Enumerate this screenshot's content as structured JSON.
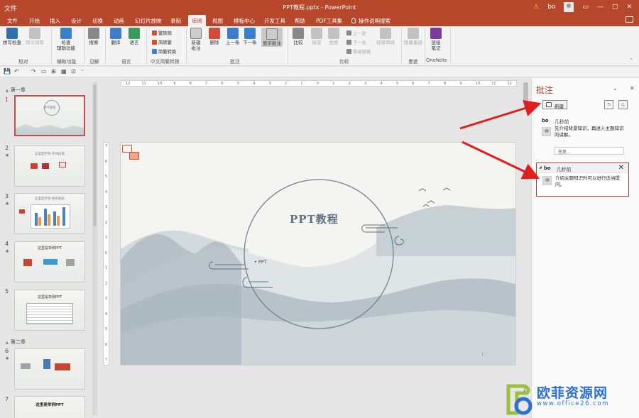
{
  "window": {
    "title": "PPT教程.pptx - PowerPoint",
    "user": "bo",
    "controls": [
      "—",
      "□",
      "✕"
    ]
  },
  "qat": {
    "save": "💾",
    "undo": "↶",
    "redo": "↷"
  },
  "tabs": [
    "文件",
    "开始",
    "插入",
    "设计",
    "切换",
    "动画",
    "幻灯片放映",
    "录制",
    "审阅",
    "视图",
    "模板中心",
    "开发工具",
    "帮助",
    "PDF工具集",
    "操作说明搜索"
  ],
  "active_tab": "审阅",
  "ribbon": {
    "proofing": {
      "label": "校对",
      "spell": "拼写检查",
      "thesaurus": "同义词库"
    },
    "accessibility": {
      "label": "辅助功能",
      "check": "检查\n辅助功能"
    },
    "insights": {
      "label": "见解",
      "search": "搜索"
    },
    "language": {
      "label": "语言",
      "translate": "翻译",
      "language": "语言"
    },
    "chinese": {
      "label": "中文简繁转换",
      "t2s": "繁转简",
      "s2t": "简转繁",
      "convert": "简繁转换"
    },
    "comments": {
      "label": "批注",
      "new": "新建\n批注",
      "delete": "删除",
      "prev": "上一条",
      "next": "下一条",
      "show": "显示批注"
    },
    "compare": {
      "label": "比较",
      "compare": "比较",
      "accept": "接受",
      "reject": "拒绝",
      "prev": "上一处",
      "next": "下一处",
      "pane": "审阅窗格",
      "end": "结束审阅"
    },
    "ink": {
      "label": "墨迹",
      "hide": "隐藏墨迹"
    },
    "onenote": {
      "label": "OneNote",
      "link": "链接\n笔记"
    }
  },
  "slides_panel": {
    "sections": [
      "第一章",
      "第二章"
    ],
    "slides": [
      {
        "num": "1",
        "title": "PPT教程"
      },
      {
        "num": "2",
        "title": "这里是字符·字体段落"
      },
      {
        "num": "3",
        "title": "这里是字符·柱形图表"
      },
      {
        "num": "4",
        "title": "这里是举例PPT"
      },
      {
        "num": "5",
        "title": "这里是举例PPT"
      },
      {
        "num": "6",
        "title": ""
      },
      {
        "num": "7",
        "title": "这里是举例PPT"
      }
    ]
  },
  "slide": {
    "title": "PPT教程",
    "subtitle": "• PPT",
    "page_number": "1"
  },
  "comments_pane": {
    "title": "批注",
    "new_button": "新建",
    "comments": [
      {
        "author": "bo",
        "time": "几秒前",
        "text": "先介绍背景知识，再进入主题知识的讲解。",
        "reply_placeholder": "答复..."
      },
      {
        "author": "bo",
        "time": "几秒前",
        "text": "介绍主题知识时可以进行适当提问。"
      }
    ]
  },
  "watermark": {
    "text": "欧菲资源网",
    "url": "www.office26.com"
  },
  "colors": {
    "accent": "#b7472a",
    "annotation_arrow": "#e11d1d",
    "watermark": "#2e6fd0"
  },
  "ruler": {
    "h": [
      "12",
      "11",
      "10",
      "9",
      "8",
      "7",
      "6",
      "5",
      "4",
      "3",
      "2",
      "1",
      "0",
      "1",
      "2",
      "3",
      "4",
      "5",
      "6",
      "7",
      "8",
      "9",
      "10",
      "11",
      "12"
    ],
    "v": [
      "7",
      "6",
      "5",
      "4",
      "3",
      "2",
      "1",
      "0",
      "1",
      "2",
      "3",
      "4",
      "5",
      "6",
      "7"
    ]
  }
}
